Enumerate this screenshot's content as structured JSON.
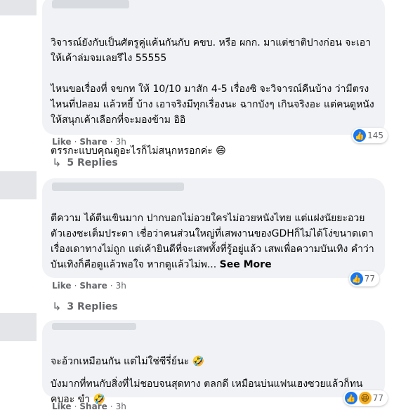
{
  "comments": [
    {
      "text": "วิจารณ์ยังกับเป็นศัตรูคู่แค้นกันกับ คขบ. หรือ ผกก. มาแต่ชาติปางก่อน จะเอาให้เค้าล่มจมเลยรึไง 55555\n\nไหนขอเรื่องที่ จขกท ให้ 10/10 มาสัก 4-5 เรื่องซิ จะวิจารณ์คืนบ้าง ว่ามีตรงไหนที่ปลอม แล้วหยี้ บ้าง เอาจริงมีทุกเรื่องนะ ฉากบังๆ เกินจริงอะ แต่คนดูหนังให้สนุกเค้าเลือกที่จะมองข้าม อิอิ\n\nตรรกะแบบคุณดูอะไรก็ไม่สนุกหรอกค่ะ",
      "emoji": "😄",
      "reaction_count": "145",
      "reaction_icons": [
        "like-icon"
      ],
      "like_label": "Like",
      "share_label": "Share",
      "separator": "·",
      "time": "3h",
      "replies_label": "5 Replies"
    },
    {
      "text": "ตีความ ได้ตีนเขินมาก ปากบอกไม่อวยใครไม่อวยหนังไทย แต่แฝงนัยยะอวยตัวเองซะเต็มประดา เชื่อว่าคนส่วนใหญ่ที่เสพงานของGDHก็ไม่ได้โง่ขนาดเดาเรื่องเดาทางไม่ถูก แต่เค้ายินดีที่จะเสพทั้งที่รู้อยู่แล้ว เสพเพื่อความบันเทิง คำว่าบันเทิงก็คือดูแล้วพอใจ หากดูแล้วไม่พ...",
      "see_more": "See More",
      "reaction_count": "77",
      "reaction_icons": [
        "like-icon"
      ],
      "like_label": "Like",
      "share_label": "Share",
      "separator": "·",
      "time": "3h",
      "replies_label": "3 Replies"
    },
    {
      "text1": "จะอ้วกเหมือนกัน แต่ไม่ใช่ซีรี่ย์นะ",
      "emoji1": "🤣",
      "text2": "บังมากที่ทนกับสิ่งที่ไม่ชอบจนสุดทาง ตลกดี เหมือนบ่นแฟนเฮงซวยแล้วก็ทนคบอะ ขำ",
      "emoji2": "🤣",
      "reaction_count": "77",
      "reaction_icons": [
        "like-icon",
        "haha-icon"
      ],
      "like_label": "Like",
      "share_label": "Share",
      "separator": "·",
      "time": "3h"
    }
  ],
  "colors": {
    "like": "#1877f2",
    "haha": "#f7b125",
    "bubble": "#f0f2f5",
    "meta": "#65676b"
  }
}
